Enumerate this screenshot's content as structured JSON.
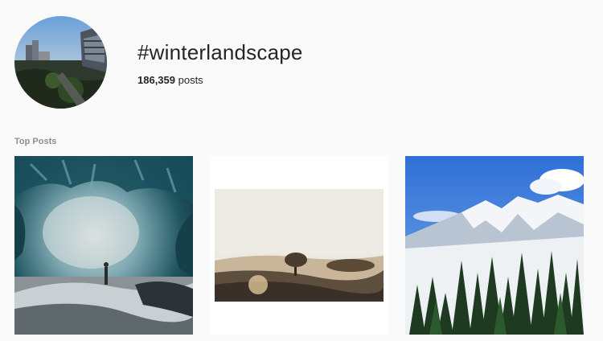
{
  "header": {
    "hashtag": "#winterlandscape",
    "post_count": "186,359",
    "post_count_suffix": " posts",
    "avatar_icon": "hashtag-avatar-city-photo"
  },
  "top_posts": {
    "label": "Top Posts",
    "posts": [
      {
        "subject": "ice cave",
        "icon": "ice-cave-photo"
      },
      {
        "subject": "misty field with tree",
        "icon": "foggy-field-photo"
      },
      {
        "subject": "snowy mountains with pine forest",
        "icon": "snowy-mountain-photo"
      }
    ]
  },
  "colors": {
    "background": "#fafafa",
    "text": "#262626",
    "muted": "#8e8e8e"
  }
}
